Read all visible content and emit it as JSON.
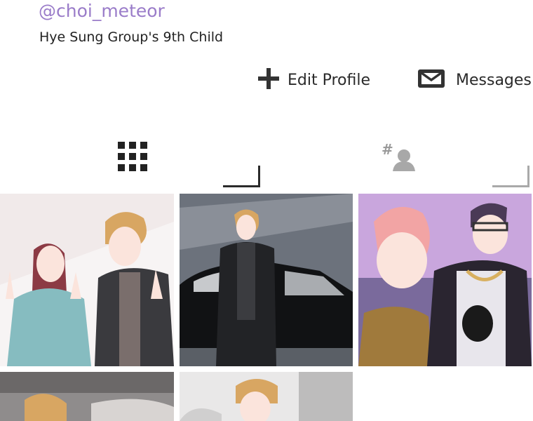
{
  "profile": {
    "handle": "@choi_meteor",
    "bio": "Hye Sung Group's 9th Child"
  },
  "actions": {
    "edit_label": "Edit  Profile",
    "edit_icon": "plus-icon",
    "messages_label": "Messages",
    "messages_icon": "envelope-icon"
  },
  "tabs": [
    {
      "name": "grid",
      "icon": "grid-icon",
      "active": true
    },
    {
      "name": "tagged",
      "icon": "tagged-person-icon",
      "active": false
    }
  ],
  "posts": [
    {
      "id": "post-1",
      "subject": "couple-peace-sign"
    },
    {
      "id": "post-2",
      "subject": "man-by-car"
    },
    {
      "id": "post-3",
      "subject": "two-friends-purple"
    },
    {
      "id": "post-4",
      "subject": "partial-grey"
    },
    {
      "id": "post-5",
      "subject": "partial-man"
    }
  ],
  "colors": {
    "handle": "#9a7cc9",
    "active_tab": "#2b2b2b",
    "inactive_tab": "#a9a9a9"
  }
}
